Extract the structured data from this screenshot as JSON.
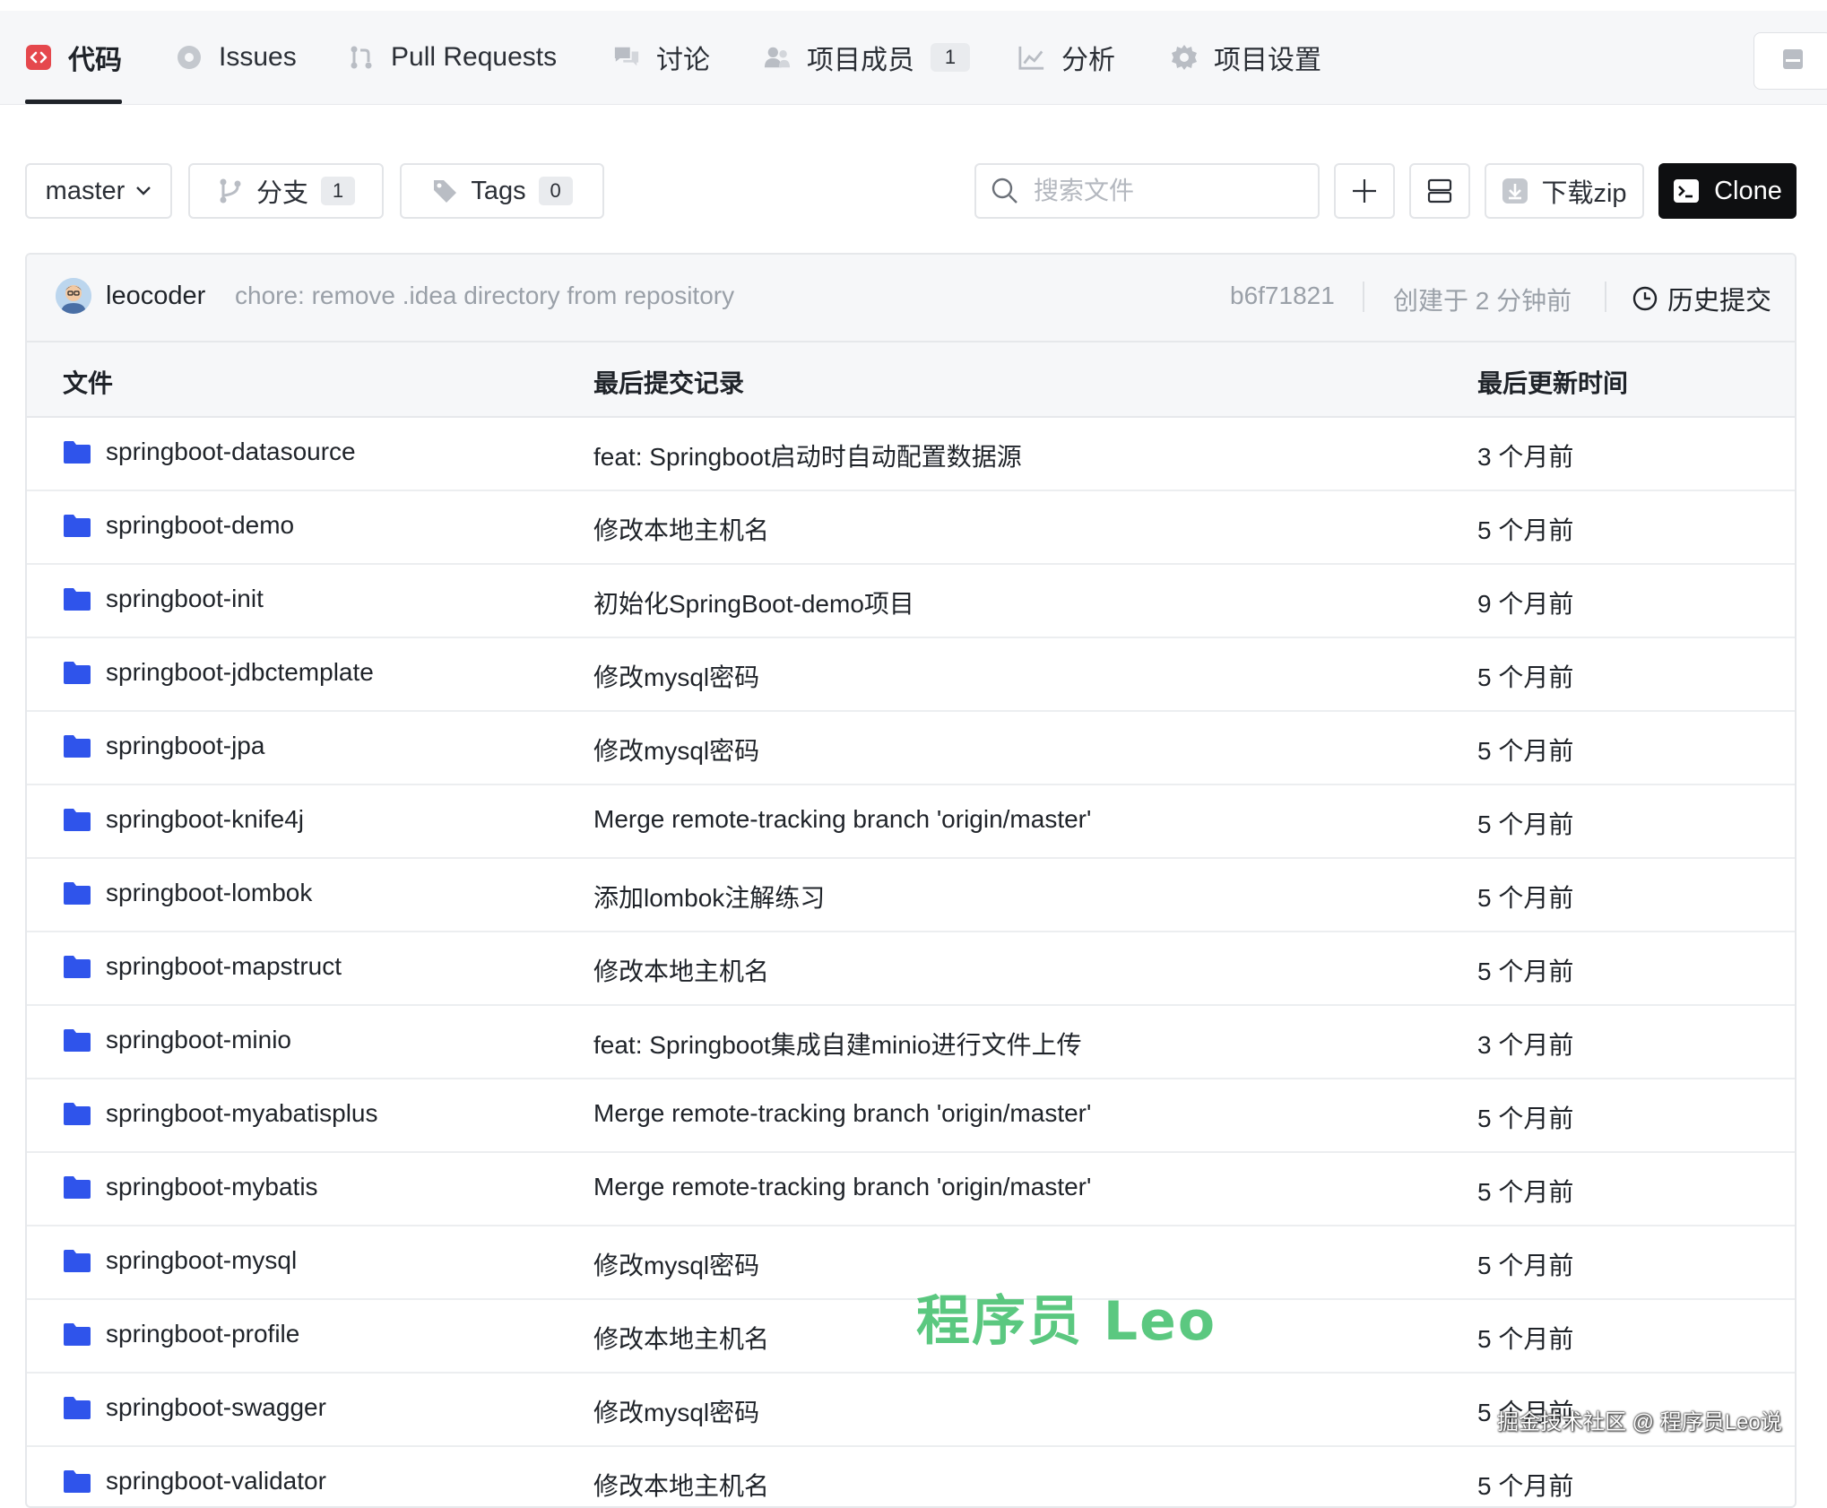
{
  "tabs": [
    {
      "label": "代码",
      "active": true
    },
    {
      "label": "Issues"
    },
    {
      "label": "Pull Requests"
    },
    {
      "label": "讨论"
    },
    {
      "label": "项目成员",
      "count": "1"
    },
    {
      "label": "分析"
    },
    {
      "label": "项目设置"
    }
  ],
  "toolbar": {
    "branch": "master",
    "branches_label": "分支",
    "branches_count": "1",
    "tags_label": "Tags",
    "tags_count": "0",
    "search_placeholder": "搜索文件",
    "download_label": "下载zip",
    "clone_label": "Clone"
  },
  "commit": {
    "author": "leocoder",
    "message": "chore: remove .idea directory from repository",
    "hash": "b6f71821",
    "created": "创建于 2 分钟前",
    "history_label": "历史提交"
  },
  "table": {
    "headers": {
      "file": "文件",
      "last_commit": "最后提交记录",
      "updated": "最后更新时间"
    },
    "rows": [
      {
        "name": "springboot-datasource",
        "msg": "feat: Springboot启动时自动配置数据源",
        "time": "3 个月前"
      },
      {
        "name": "springboot-demo",
        "msg": "修改本地主机名",
        "time": "5 个月前"
      },
      {
        "name": "springboot-init",
        "msg": "初始化SpringBoot-demo项目",
        "time": "9 个月前"
      },
      {
        "name": "springboot-jdbctemplate",
        "msg": "修改mysql密码",
        "time": "5 个月前"
      },
      {
        "name": "springboot-jpa",
        "msg": "修改mysql密码",
        "time": "5 个月前"
      },
      {
        "name": "springboot-knife4j",
        "msg": "Merge remote-tracking branch 'origin/master'",
        "time": "5 个月前"
      },
      {
        "name": "springboot-lombok",
        "msg": "添加lombok注解练习",
        "time": "5 个月前"
      },
      {
        "name": "springboot-mapstruct",
        "msg": "修改本地主机名",
        "time": "5 个月前"
      },
      {
        "name": "springboot-minio",
        "msg": "feat: Springboot集成自建minio进行文件上传",
        "time": "3 个月前"
      },
      {
        "name": "springboot-myabatisplus",
        "msg": "Merge remote-tracking branch 'origin/master'",
        "time": "5 个月前"
      },
      {
        "name": "springboot-mybatis",
        "msg": "Merge remote-tracking branch 'origin/master'",
        "time": "5 个月前"
      },
      {
        "name": "springboot-mysql",
        "msg": "修改mysql密码",
        "time": "5 个月前"
      },
      {
        "name": "springboot-profile",
        "msg": "修改本地主机名",
        "time": "5 个月前"
      },
      {
        "name": "springboot-swagger",
        "msg": "修改mysql密码",
        "time": "5 个月前"
      },
      {
        "name": "springboot-validator",
        "msg": "修改本地主机名",
        "time": "5 个月前"
      }
    ]
  },
  "watermark": "程序员 Leo",
  "credit": "掘金技术社区 @ 程序员Leo说",
  "colors": {
    "folder": "#2f54eb",
    "code_icon": "#e5484d",
    "clone_bg": "#0e0f11"
  }
}
